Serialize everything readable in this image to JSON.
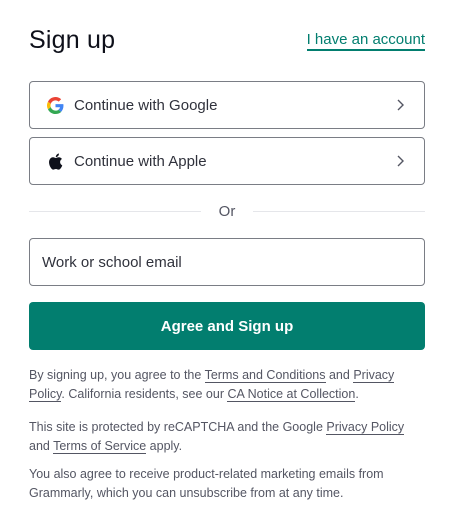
{
  "header": {
    "title": "Sign up",
    "signin_link": "I have an account"
  },
  "social": {
    "google_label": "Continue with Google",
    "apple_label": "Continue with Apple"
  },
  "divider_text": "Or",
  "email": {
    "placeholder": "Work or school email",
    "value": ""
  },
  "submit_label": "Agree and Sign up",
  "legal": {
    "p1_a": "By signing up, you agree to the ",
    "p1_terms": "Terms and Conditions",
    "p1_b": " and ",
    "p1_privacy": "Privacy Policy",
    "p1_c": ". California residents, see our ",
    "p1_ca": "CA Notice at Collection",
    "p1_d": ".",
    "p2_a": "This site is protected by reCAPTCHA and the Google ",
    "p2_privacy": "Privacy Policy",
    "p2_b": " and ",
    "p2_tos": "Terms of Service",
    "p2_c": " apply.",
    "p3": "You also agree to receive product-related marketing emails from Grammarly, which you can unsubscribe from at any time."
  },
  "colors": {
    "accent": "#027e6f",
    "border": "#7a7d85",
    "text": "#0e101a",
    "muted": "#545663"
  },
  "icons": {
    "google": "google-icon",
    "apple": "apple-icon",
    "chevron": "chevron-right-icon"
  }
}
